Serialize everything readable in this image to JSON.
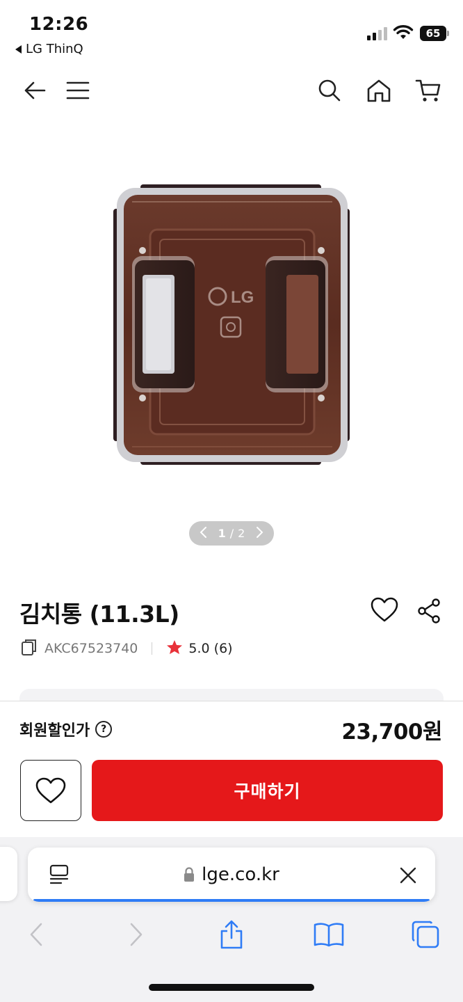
{
  "status_bar": {
    "time": "12:26",
    "back_app": "LG ThinQ",
    "battery": "65"
  },
  "header": {
    "icons": [
      "back-arrow-icon",
      "menu-icon",
      "search-icon",
      "home-icon",
      "cart-icon"
    ]
  },
  "gallery": {
    "current": "1",
    "separator": "/",
    "total": "2"
  },
  "product": {
    "title": "김치통 (11.3L)",
    "model": "AKC67523740",
    "rating": "5.0 (6)",
    "accent_color": "#e5181a",
    "star_color": "#e8323a"
  },
  "purchase": {
    "price_label": "회원할인가",
    "help_symbol": "?",
    "price": "23,700원",
    "buy_label": "구매하기"
  },
  "browser": {
    "url": "lge.co.kr",
    "progress_color": "#2f7cf6"
  }
}
